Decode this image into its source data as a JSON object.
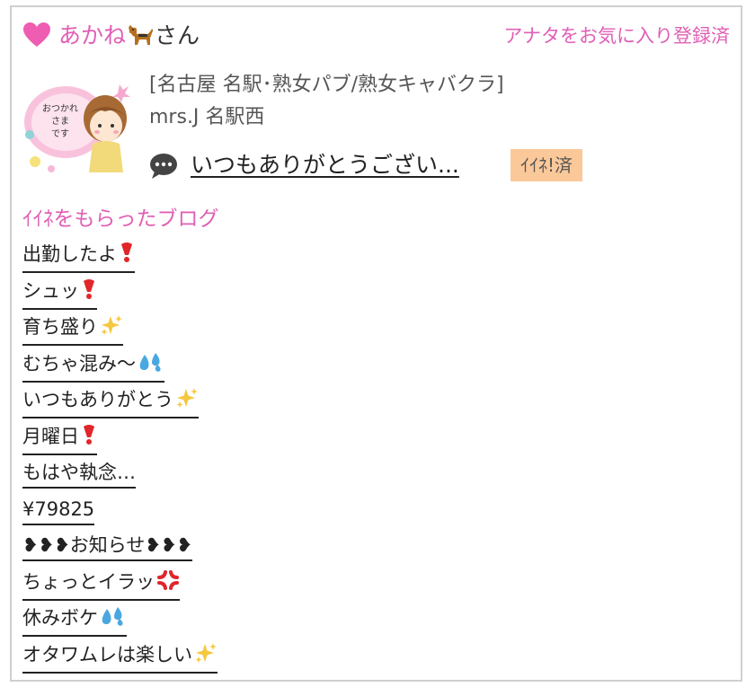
{
  "header": {
    "username": "あかね",
    "username_suffix": "さん",
    "fav_status": "アナタをお気に入り登録済"
  },
  "profile": {
    "avatar_text": [
      "おつかれ",
      "さま",
      "です"
    ],
    "shop_name": "[名古屋 名駅･熟女パブ/熟女キャバクラ]",
    "store_name": "mrs.J 名駅西",
    "message_preview": "いつもありがとうござい...",
    "iine_badge": "ｲｲﾈ!済"
  },
  "blog_section": {
    "title": "ｲｲﾈをもらったブログ",
    "items": [
      {
        "label": "出勤したよ",
        "emoji": "red-exclamation"
      },
      {
        "label": "シュッ",
        "emoji": "red-exclamation"
      },
      {
        "label": "育ち盛り",
        "emoji": "sparkles"
      },
      {
        "label": "むちゃ混み〜",
        "emoji": "sweat-droplets"
      },
      {
        "label": "いつもありがとう",
        "emoji": "sparkles"
      },
      {
        "label": "月曜日",
        "emoji": "red-exclamation"
      },
      {
        "label": "もはや執念…",
        "emoji": ""
      },
      {
        "label": "¥79825",
        "emoji": ""
      },
      {
        "label": "❥❥❥お知らせ❥❥❥",
        "emoji": ""
      },
      {
        "label": "ちょっとイラッ",
        "emoji": "anger-symbol"
      },
      {
        "label": "休みボケ",
        "emoji": "sweat-droplets"
      },
      {
        "label": "オタワムレは楽しい",
        "emoji": "sparkles"
      }
    ]
  },
  "colors": {
    "accent_pink": "#e05fb5",
    "badge_bg": "#fbc89a",
    "border": "#cfcfcf",
    "text": "#222222"
  }
}
